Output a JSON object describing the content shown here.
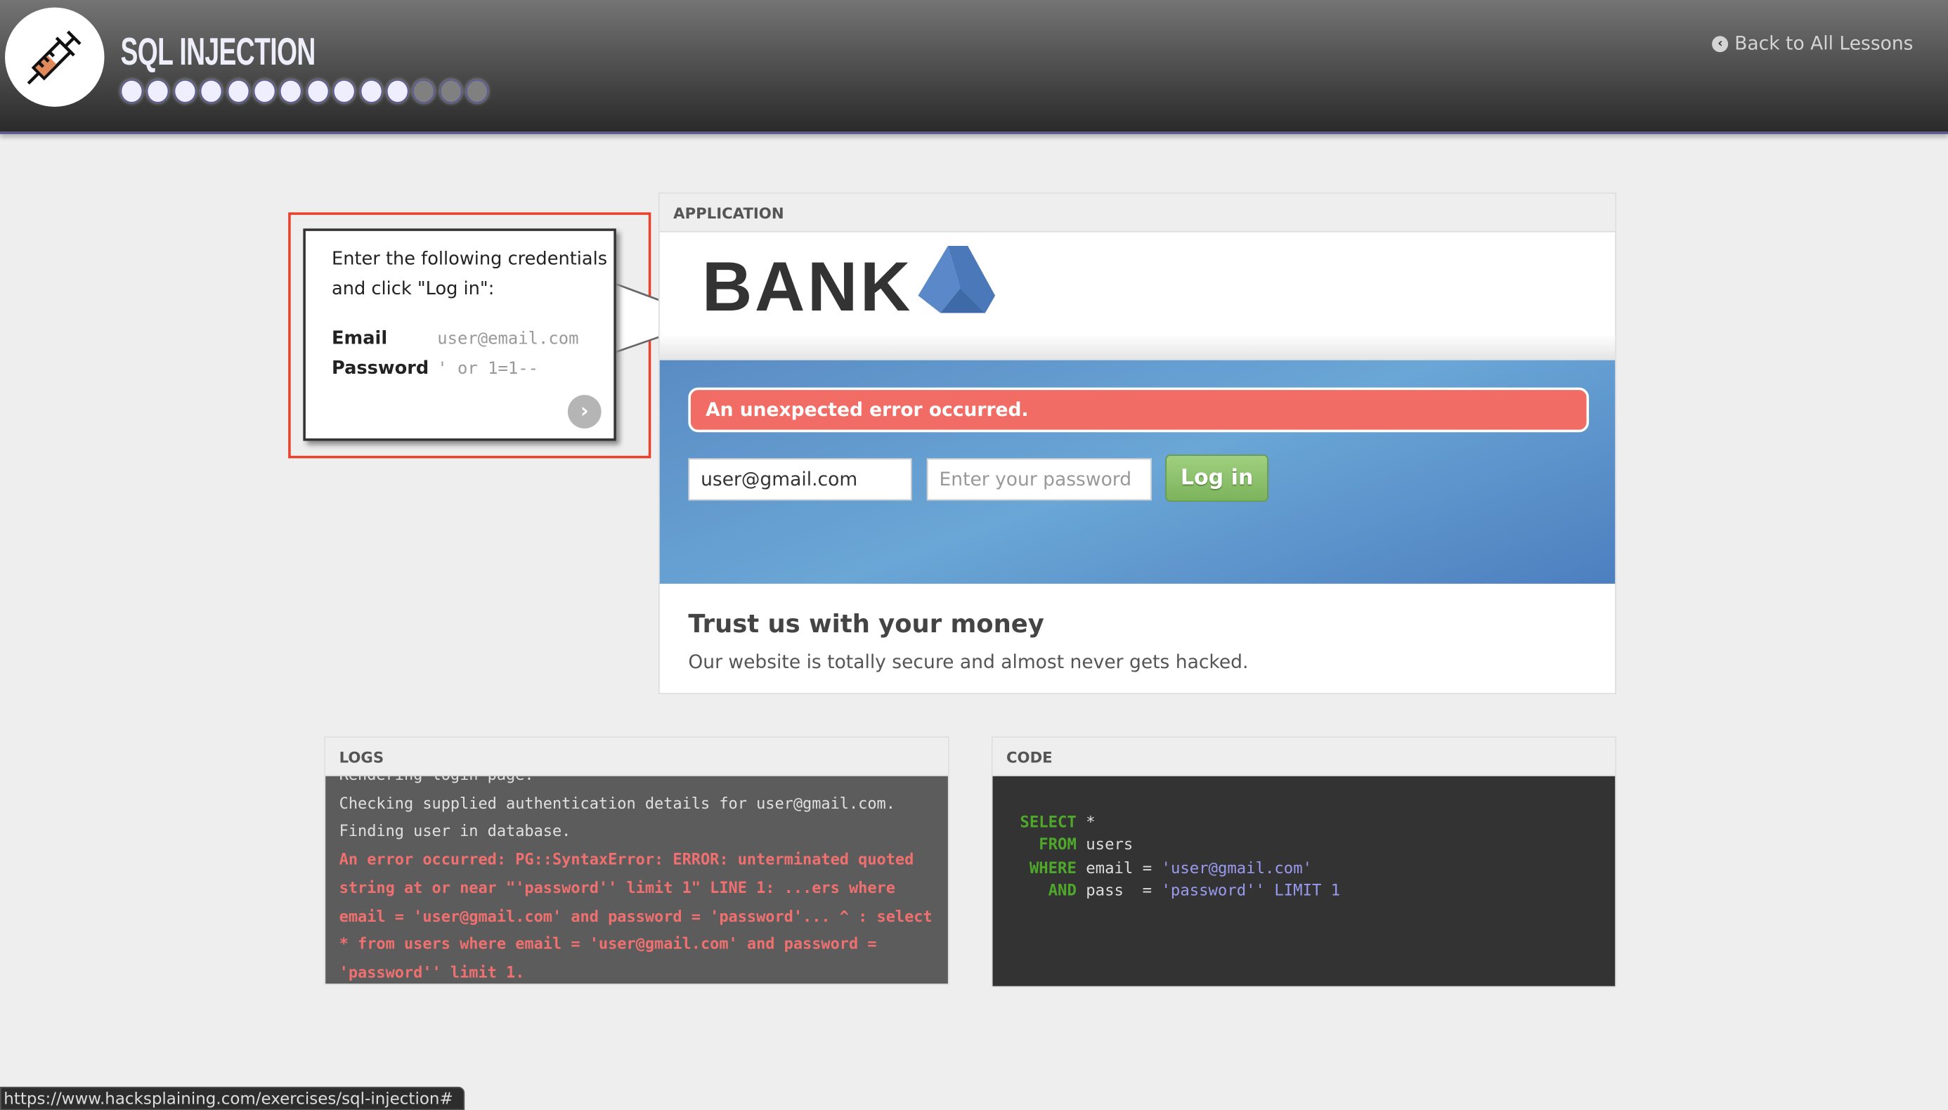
{
  "header": {
    "title": "SQL INJECTION",
    "progress": {
      "completed": 11,
      "total": 14
    },
    "back_link": "Back to All Lessons",
    "back_icon": "arrow-circle-left-icon",
    "logo_icon": "syringe-icon"
  },
  "instructions": {
    "intro": "Enter the following credentials and click \"Log in\":",
    "email_label": "Email",
    "email_value": "user@email.com",
    "password_label": "Password",
    "password_value": "' or 1=1--",
    "next_icon": "chevron-right-icon"
  },
  "application": {
    "heading": "APPLICATION",
    "brand": "BANK",
    "error": "An unexpected error occurred.",
    "email_value": "user@gmail.com",
    "password_placeholder": "Enter your password",
    "login_label": "Log in",
    "tagline": "Trust us with your money",
    "subtext": "Our website is totally secure and almost never gets hacked."
  },
  "logs": {
    "heading": "LOGS",
    "lines": [
      "Rendering login page.",
      "Checking supplied authentication details for user@gmail.com.",
      "Finding user in database."
    ],
    "error": "An error occurred: PG::SyntaxError: ERROR: unterminated quoted string at or near \"'password'' limit 1\" LINE 1: ...ers where email = 'user@gmail.com' and password = 'password'... ^ : select * from users where email = 'user@gmail.com' and password = 'password'' limit 1."
  },
  "code": {
    "heading": "CODE",
    "kw1": "SELECT",
    "t1": " *",
    "kw2": "FROM",
    "t2": " users",
    "kw3": "WHERE",
    "t3": " email = ",
    "s3": "'user@gmail.com'",
    "kw4": "AND",
    "t4": " pass  = ",
    "s4": "'password'' LIMIT 1"
  },
  "status_url": "https://www.hacksplaining.com/exercises/sql-injection#",
  "colors": {
    "error": "#f06c64",
    "login": "#8dc06e",
    "highlight": "#e8412c"
  }
}
